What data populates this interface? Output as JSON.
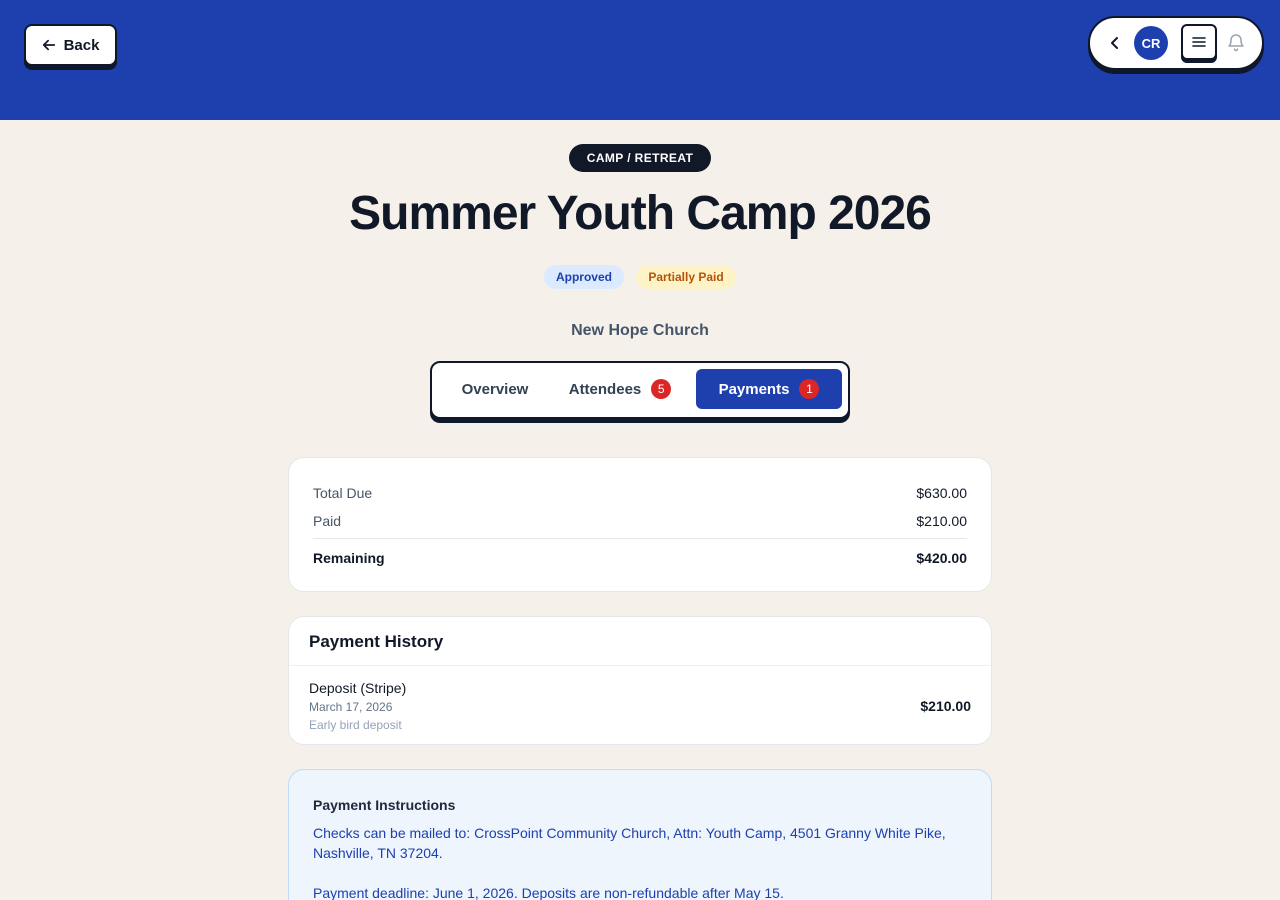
{
  "header": {
    "back_label": "Back",
    "user_initials": "CR",
    "icons": {
      "back": "arrow-left-icon",
      "collapse": "chevron-left-icon",
      "menu": "hamburger-menu-icon",
      "notifications": "bell-icon"
    },
    "colors": {
      "brand": "#1e40af",
      "ink": "#0f172a",
      "background": "#f5f1ea"
    }
  },
  "event": {
    "category": "CAMP / RETREAT",
    "title": "Summer Youth Camp 2026",
    "status_badges": {
      "approved": "Approved",
      "payment": "Partially Paid"
    },
    "organization": "New Hope Church"
  },
  "tabs": {
    "overview": "Overview",
    "attendees": "Attendees",
    "attendees_count": "5",
    "payments": "Payments",
    "payments_count": "1",
    "active": "Payments"
  },
  "summary": {
    "total_label": "Total Due",
    "total_value": "$630.00",
    "paid_label": "Paid",
    "paid_value": "$210.00",
    "remaining_label": "Remaining",
    "remaining_value": "$420.00"
  },
  "history": {
    "title": "Payment History",
    "items": [
      {
        "title": "Deposit (Stripe)",
        "date": "March 17, 2026",
        "note": "Early bird deposit",
        "amount": "$210.00"
      }
    ]
  },
  "instructions": {
    "title": "Payment Instructions",
    "line1": "Checks can be mailed to: CrossPoint Community Church, Attn: Youth Camp, 4501 Granny White Pike, Nashville, TN 37204.",
    "line2": "Payment deadline: June 1, 2026. Deposits are non-refundable after May 15."
  }
}
